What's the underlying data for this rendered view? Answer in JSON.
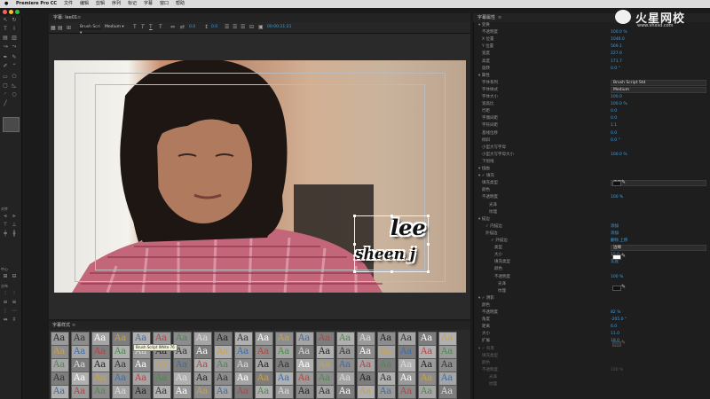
{
  "menubar": {
    "app": "Premiere Pro CC",
    "items": [
      "文件",
      "编辑",
      "剪辑",
      "序列",
      "标记",
      "字幕",
      "窗口",
      "帮助"
    ]
  },
  "title_panel": {
    "tab": "字幕: lee01",
    "font": "Brush Scri",
    "style": "Medium",
    "val1": "0.0",
    "val2": "0.0",
    "timecode": "00:00:21:21"
  },
  "title_text": {
    "line1": "lee",
    "line2": "sheen j"
  },
  "styles_panel": {
    "tab": "字幕样式",
    "tooltip": "Brush Script White 76",
    "swatches": [
      [
        "Aa",
        "Aa",
        "Aa",
        "Aa",
        "Aa",
        "Aa",
        "Aa",
        "Aa",
        "Aa",
        "Aa",
        "Aa",
        "Aa",
        "Aa",
        "Aa",
        "Aa",
        "Aa",
        "Aa",
        "Aa",
        "Aa",
        "Aa"
      ],
      [
        "Aa",
        "Aa",
        "Aa",
        "Aa",
        "Aa",
        "Aa",
        "Aa",
        "Aa",
        "Aa",
        "Aa",
        "Aa",
        "Aa",
        "Aa",
        "Aa",
        "Aa",
        "Aa",
        "Aa",
        "Aa",
        "Aa",
        "Aa"
      ],
      [
        "Aa",
        "Aa",
        "Aa",
        "Aa",
        "Aa",
        "Aa",
        "Aa",
        "Aa",
        "Aa",
        "Aa",
        "Aa",
        "Aa",
        "Aa",
        "Aa",
        "Aa",
        "Aa",
        "Aa",
        "Aa",
        "Aa",
        "Aa"
      ],
      [
        "Aa",
        "Aa",
        "Aa",
        "Aa",
        "Aa",
        "Aa",
        "Aa",
        "Aa",
        "Aa",
        "Aa",
        "Aa",
        "Aa",
        "Aa",
        "Aa",
        "Aa",
        "Aa",
        "Aa",
        "Aa",
        "Aa",
        "Aa"
      ],
      [
        "Aa",
        "Aa",
        "Aa",
        "Aa",
        "Aa",
        "Aa",
        "Aa",
        "Aa",
        "Aa",
        "Aa",
        "Aa",
        "Aa",
        "Aa",
        "Aa",
        "Aa",
        "Aa",
        "Aa",
        "Aa",
        "Aa",
        "Aa"
      ]
    ]
  },
  "props_panel": {
    "tab": "字幕属性",
    "rows": [
      {
        "label": "变换",
        "value": ""
      },
      {
        "label": "不透明度",
        "value": "100.0 %"
      },
      {
        "label": "X 位置",
        "value": "1046.0"
      },
      {
        "label": "Y 位置",
        "value": "569.1"
      },
      {
        "label": "宽度",
        "value": "227.6"
      },
      {
        "label": "高度",
        "value": "171.7"
      },
      {
        "label": "旋转",
        "value": "0.0 °"
      },
      {
        "label": "属性",
        "value": ""
      },
      {
        "label": "字体系列",
        "value": "Brush Script Std"
      },
      {
        "label": "字体样式",
        "value": "Medium"
      },
      {
        "label": "字体大小",
        "value": "100.0"
      },
      {
        "label": "宽高比",
        "value": "100.0 %"
      },
      {
        "label": "行距",
        "value": "0.0"
      },
      {
        "label": "字偶间距",
        "value": "0.0"
      },
      {
        "label": "字符间距",
        "value": "1.1"
      },
      {
        "label": "基线位移",
        "value": "0.0"
      },
      {
        "label": "倾斜",
        "value": "0.0 °"
      },
      {
        "label": "小型大写字母",
        "value": ""
      },
      {
        "label": "小型大写字母大小",
        "value": "100.0 %"
      },
      {
        "label": "下划线",
        "value": ""
      },
      {
        "label": "扭曲",
        "value": ""
      },
      {
        "label": "填充",
        "value": ""
      },
      {
        "label": "填充类型",
        "value": "实底"
      },
      {
        "label": "颜色",
        "value": ""
      },
      {
        "label": "不透明度",
        "value": "100 %"
      },
      {
        "label": "光泽",
        "value": ""
      },
      {
        "label": "纹理",
        "value": ""
      },
      {
        "label": "描边",
        "value": ""
      },
      {
        "label": "内描边",
        "value": "添加"
      },
      {
        "label": "外描边",
        "value": "添加"
      },
      {
        "label": "外描边",
        "value": "删除  上移"
      },
      {
        "label": "类型",
        "value": "边缘"
      },
      {
        "label": "大小",
        "value": "15.0"
      },
      {
        "label": "填充类型",
        "value": "实底"
      },
      {
        "label": "颜色",
        "value": ""
      },
      {
        "label": "不透明度",
        "value": "100 %"
      },
      {
        "label": "光泽",
        "value": ""
      },
      {
        "label": "纹理",
        "value": ""
      },
      {
        "label": "阴影",
        "value": ""
      },
      {
        "label": "颜色",
        "value": ""
      },
      {
        "label": "不透明度",
        "value": "82 %"
      },
      {
        "label": "角度",
        "value": "-205.0 °"
      },
      {
        "label": "距离",
        "value": "6.0"
      },
      {
        "label": "大小",
        "value": "11.0"
      },
      {
        "label": "扩展",
        "value": "18.0"
      },
      {
        "label": "背景",
        "value": ""
      },
      {
        "label": "填充类型",
        "value": ""
      },
      {
        "label": "颜色",
        "value": ""
      },
      {
        "label": "不透明度",
        "value": "100 %"
      },
      {
        "label": "光泽",
        "value": ""
      },
      {
        "label": "纹理",
        "value": ""
      }
    ]
  },
  "watermark": {
    "name": "火星网校",
    "url": "www.vhxsd.com"
  },
  "left_labels": {
    "a": "对齐",
    "b": "中心",
    "c": "分布"
  }
}
